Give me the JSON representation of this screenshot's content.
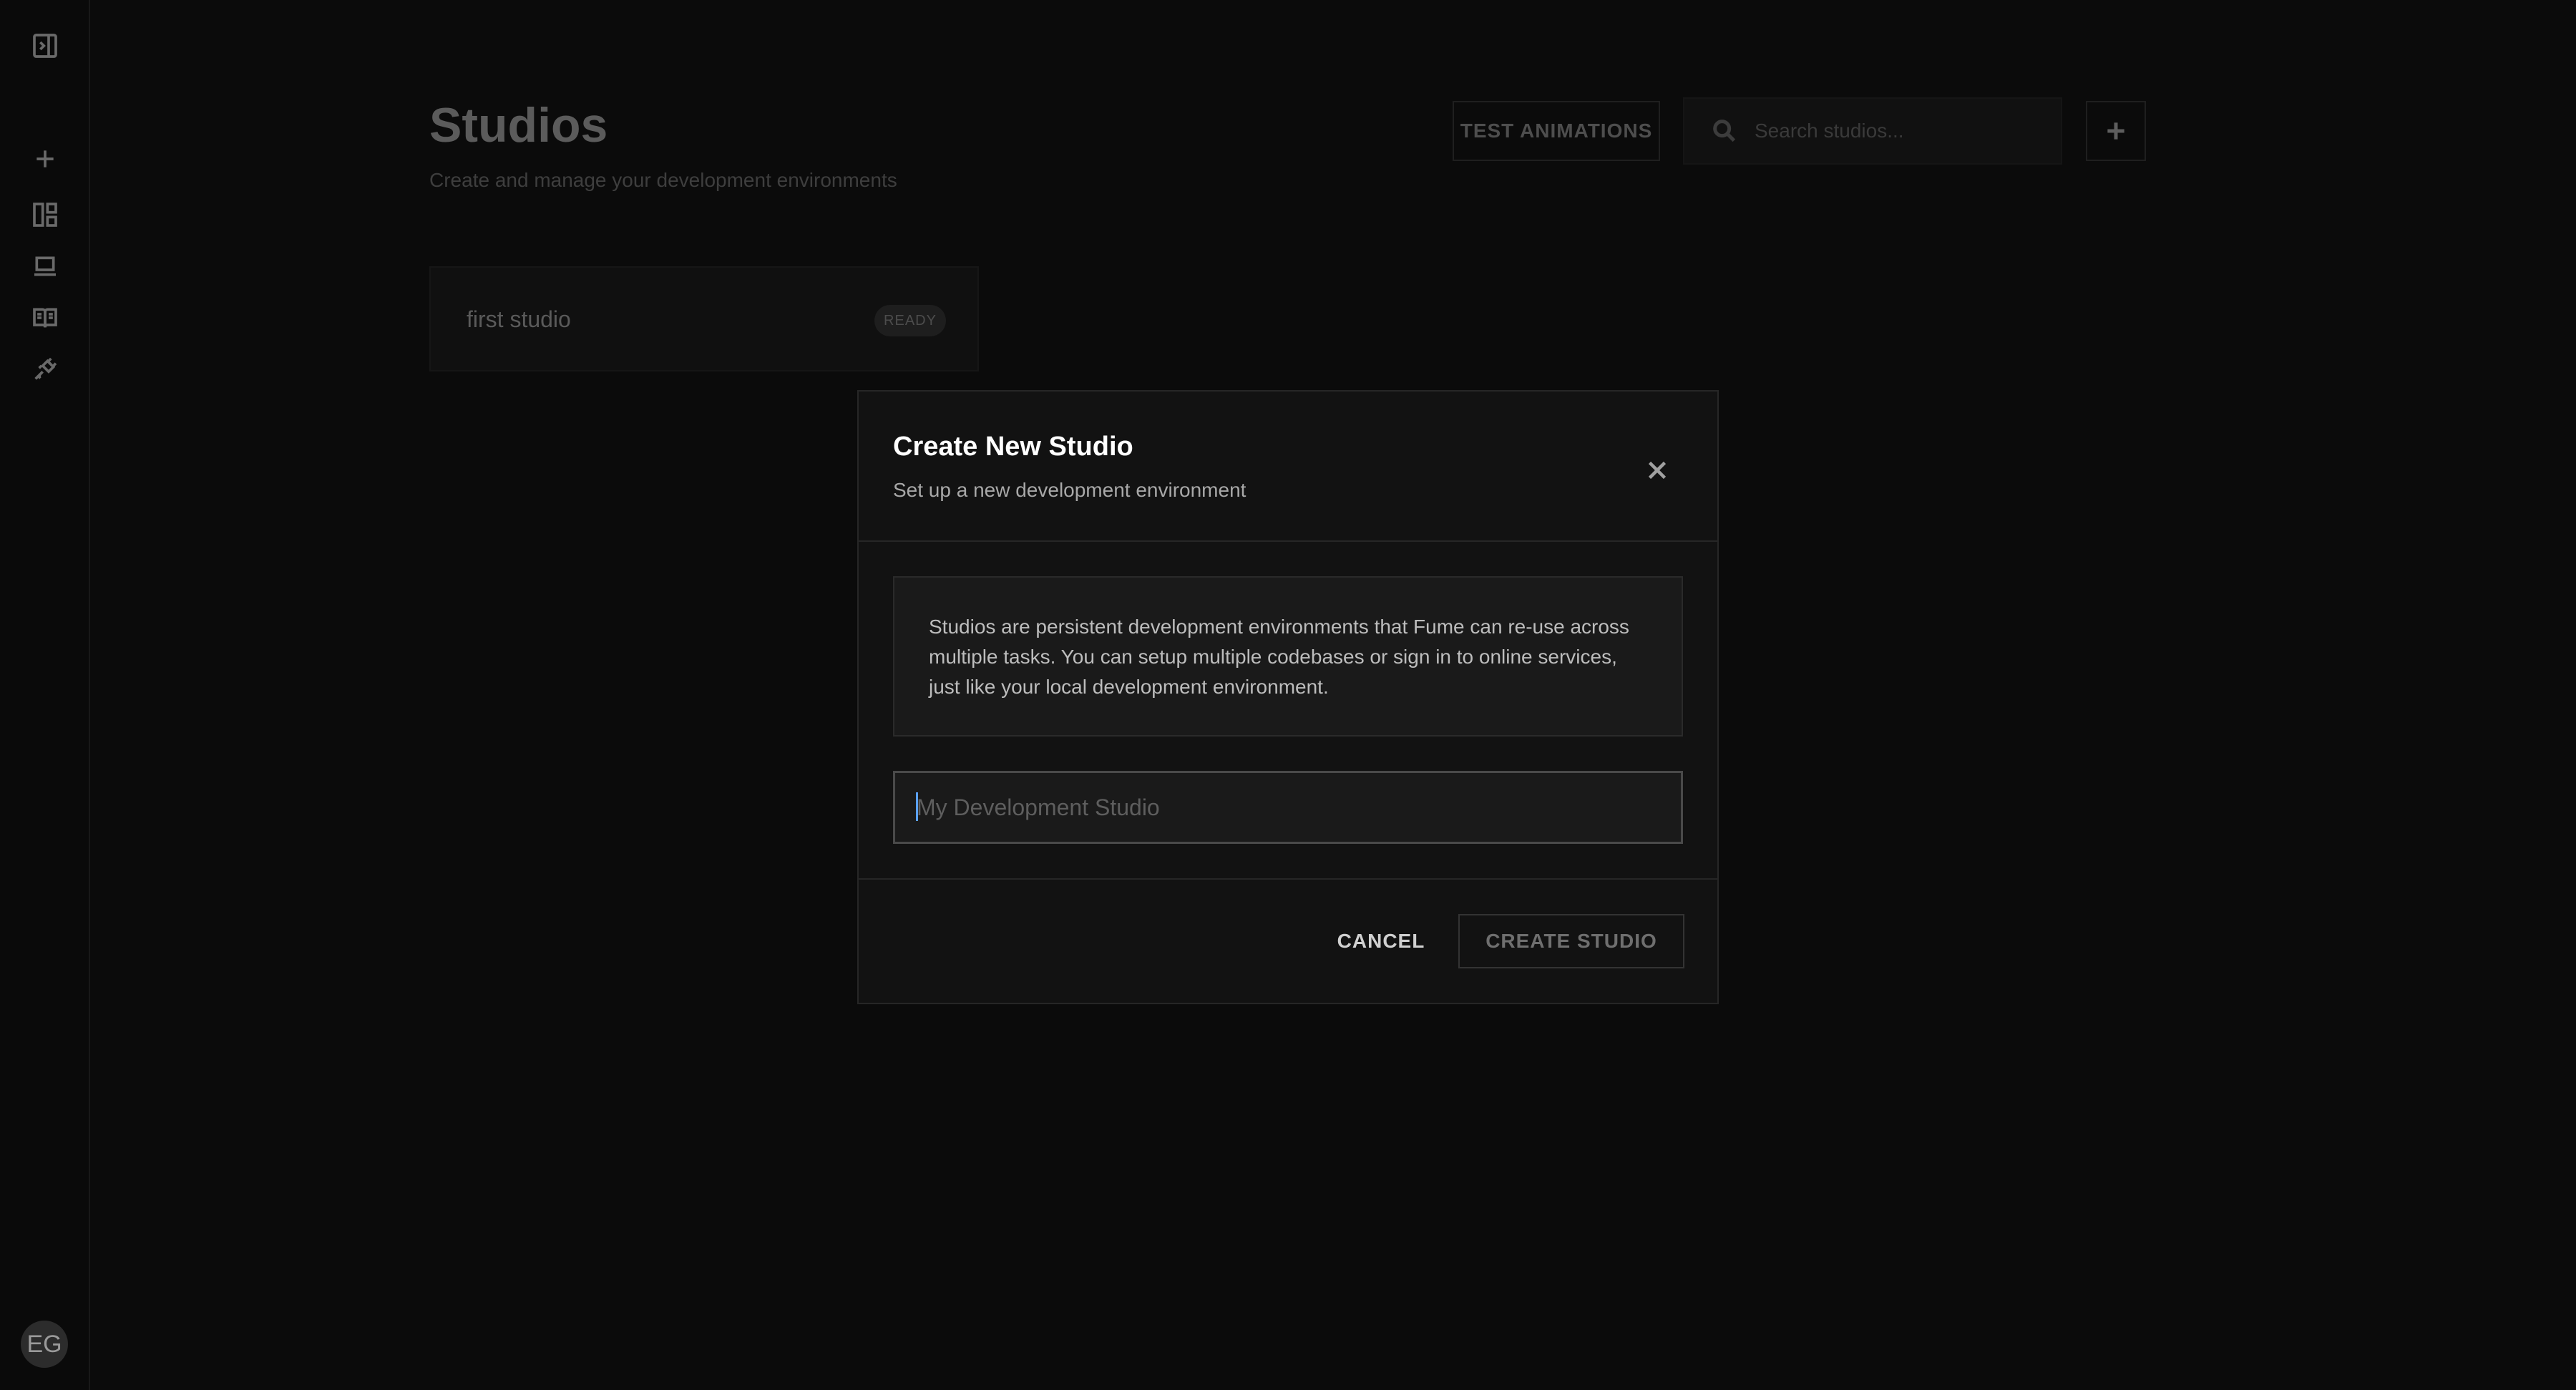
{
  "sidebar": {
    "avatar_initials": "EG",
    "icons": [
      "sidebar-toggle-icon",
      "plus-icon",
      "dashboard-icon",
      "laptop-icon",
      "book-icon",
      "plug-icon"
    ]
  },
  "page": {
    "title": "Studios",
    "subtitle": "Create and manage your development environments",
    "test_animations_label": "TEST ANIMATIONS",
    "search_placeholder": "Search studios..."
  },
  "studios": [
    {
      "name": "first studio",
      "status": "READY"
    }
  ],
  "modal": {
    "title": "Create New Studio",
    "subtitle": "Set up a new development environment",
    "info_text": "Studios are persistent development environments that Fume can re-use across multiple tasks. You can setup multiple codebases or sign in to online services, just like your local development environment.",
    "name_placeholder": "My Development Studio",
    "name_value": "",
    "cancel_label": "CANCEL",
    "create_label": "CREATE STUDIO"
  },
  "colors": {
    "background": "#0b0b0b",
    "modal_bg": "#121212",
    "caret": "#5aa0ff"
  }
}
